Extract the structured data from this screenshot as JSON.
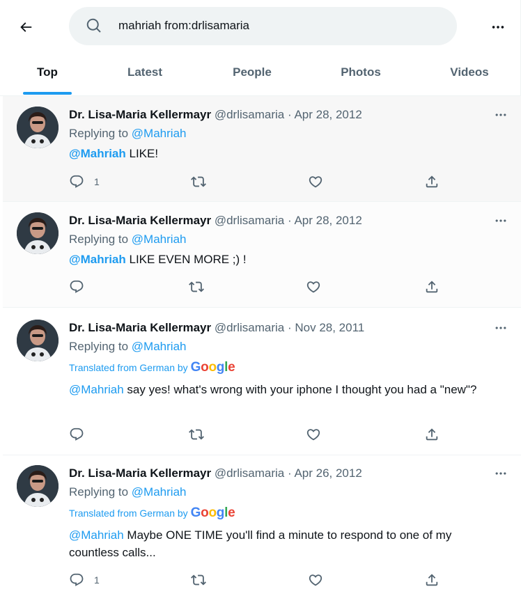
{
  "search": {
    "query": "mahriah from:drlisamaria"
  },
  "tabs": [
    {
      "label": "Top"
    },
    {
      "label": "Latest"
    },
    {
      "label": "People"
    },
    {
      "label": "Photos"
    },
    {
      "label": "Videos"
    }
  ],
  "tweets": [
    {
      "name": "Dr. Lisa-Maria Kellermayr",
      "handle": "@drlisamaria",
      "dot": "·",
      "date": "Apr 28, 2012",
      "reply_prefix": "Replying to",
      "reply_to": "@Mahriah",
      "mention": "@Mahriah",
      "text": " LIKE!",
      "reply_count": "1"
    },
    {
      "name": "Dr. Lisa-Maria Kellermayr",
      "handle": "@drlisamaria",
      "dot": "·",
      "date": "Apr 28, 2012",
      "reply_prefix": "Replying to",
      "reply_to": "@Mahriah",
      "mention": "@Mahriah",
      "text": " LIKE EVEN MORE ;) !"
    },
    {
      "name": "Dr. Lisa-Maria Kellermayr",
      "handle": "@drlisamaria",
      "dot": "·",
      "date": "Nov 28, 2011",
      "reply_prefix": "Replying to",
      "reply_to": "@Mahriah",
      "translated": "Translated from German by",
      "mention": "@Mahriah",
      "text": " say yes! what's wrong with your iphone I thought you had a \"new\"?"
    },
    {
      "name": "Dr. Lisa-Maria Kellermayr",
      "handle": "@drlisamaria",
      "dot": "·",
      "date": "Apr 26, 2012",
      "reply_prefix": "Replying to",
      "reply_to": "@Mahriah",
      "translated": "Translated from German by",
      "mention": "@Mahriah",
      "text": " Maybe ONE TIME you'll find a minute to respond to one of my countless calls...",
      "reply_count": "1"
    }
  ],
  "google": {
    "g1": "G",
    "o1": "o",
    "o2": "o",
    "g2": "g",
    "l": "l",
    "e": "e"
  },
  "colors": {
    "accent": "#1d9bf0",
    "muted": "#536471",
    "text": "#0f1419",
    "hover_bg": "#f7f7f7"
  },
  "icons": {
    "back": "arrow-left-icon",
    "search": "search-icon",
    "more": "more-horizontal-icon",
    "reply": "reply-icon",
    "retweet": "retweet-icon",
    "like": "heart-icon",
    "share": "share-icon"
  }
}
